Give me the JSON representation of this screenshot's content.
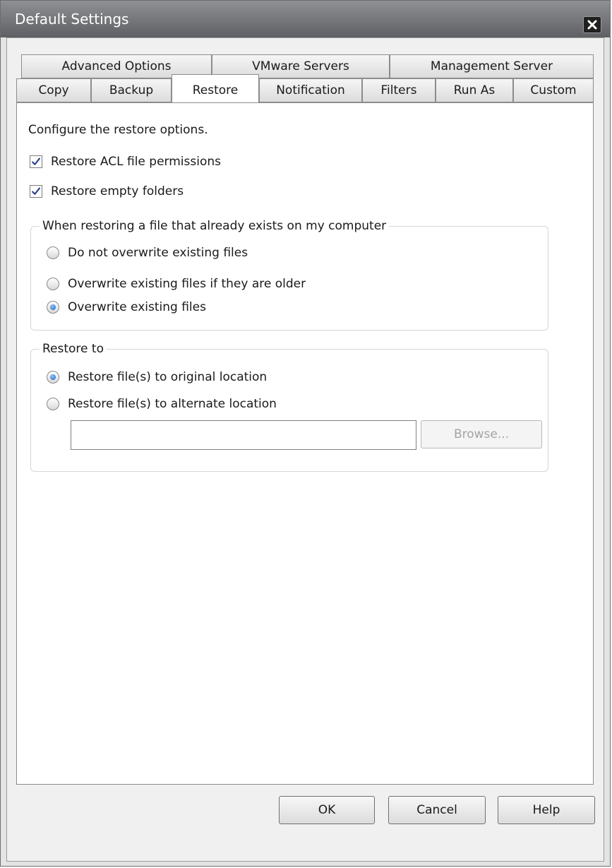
{
  "window": {
    "title": "Default Settings"
  },
  "tabs": {
    "row1": [
      "Advanced Options",
      "VMware Servers",
      "Management Server"
    ],
    "row2": [
      "Copy",
      "Backup",
      "Restore",
      "Notification",
      "Filters",
      "Run As",
      "Custom"
    ],
    "selected": "Restore"
  },
  "restore": {
    "intro": "Configure the restore options.",
    "restore_acl": {
      "label": "Restore ACL file permissions",
      "checked": true
    },
    "restore_empty": {
      "label": "Restore empty folders",
      "checked": true
    },
    "overwrite_group": {
      "legend": "When restoring a file that already exists on my computer",
      "options": [
        {
          "label": "Do not overwrite existing files",
          "selected": false
        },
        {
          "label": "Overwrite existing files if they are older",
          "selected": false
        },
        {
          "label": "Overwrite existing files",
          "selected": true
        }
      ]
    },
    "restore_to_group": {
      "legend": "Restore to",
      "options": [
        {
          "label": "Restore file(s) to original location",
          "selected": true
        },
        {
          "label": "Restore file(s) to alternate location",
          "selected": false
        }
      ],
      "path_value": "",
      "browse_label": "Browse..."
    }
  },
  "footer": {
    "ok_label": "OK",
    "cancel_label": "Cancel",
    "help_label": "Help"
  },
  "icons": {
    "close": "close-icon",
    "checkbox": "checkmark-icon",
    "radio": "radio-dot"
  },
  "colors": {
    "title_bar": "#6f7074",
    "radio_selected": "#1e5fb3",
    "checkmark": "#27408b"
  }
}
